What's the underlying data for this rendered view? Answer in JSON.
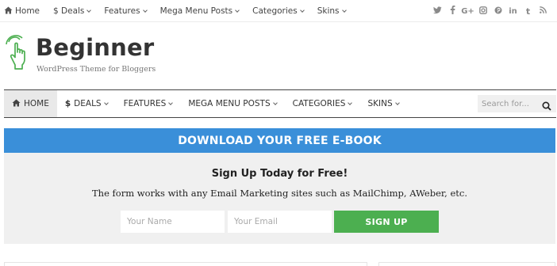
{
  "topnav": {
    "items": [
      {
        "label": "Home",
        "icon": "home-icon"
      },
      {
        "label": "$ Deals",
        "icon": ""
      },
      {
        "label": "Features",
        "icon": ""
      },
      {
        "label": "Mega Menu Posts",
        "icon": ""
      },
      {
        "label": "Categories",
        "icon": ""
      },
      {
        "label": "Skins",
        "icon": ""
      }
    ],
    "social": [
      {
        "name": "twitter-icon",
        "glyph": "t"
      },
      {
        "name": "facebook-icon",
        "glyph": "f"
      },
      {
        "name": "google-plus-icon",
        "glyph": "G+"
      },
      {
        "name": "instagram-icon",
        "glyph": "◙"
      },
      {
        "name": "pinterest-icon",
        "glyph": "℗"
      },
      {
        "name": "linkedin-icon",
        "glyph": "in"
      },
      {
        "name": "tumblr-icon",
        "glyph": "t"
      },
      {
        "name": "rss-icon",
        "glyph": ")"
      }
    ]
  },
  "header": {
    "title": "Beginner",
    "tagline": "WordPress Theme for Bloggers",
    "logo_color": "#4caf50"
  },
  "mainnav": {
    "home": "HOME",
    "deals": "DEALS",
    "deals_sign": "$",
    "features": "FEATURES",
    "mega": "MEGA MENU POSTS",
    "categories": "CATEGORIES",
    "skins": "SKINS",
    "search_placeholder": "Search for..."
  },
  "banner": {
    "text": "DOWNLOAD YOUR FREE E-BOOK",
    "color": "#3a8fd9"
  },
  "signup": {
    "heading": "Sign Up Today for Free!",
    "description": "The form works with any Email Marketing sites such as MailChimp, AWeber, etc.",
    "name_placeholder": "Your Name",
    "email_placeholder": "Your Email",
    "button": "SIGN UP",
    "button_color": "#4caf50"
  }
}
